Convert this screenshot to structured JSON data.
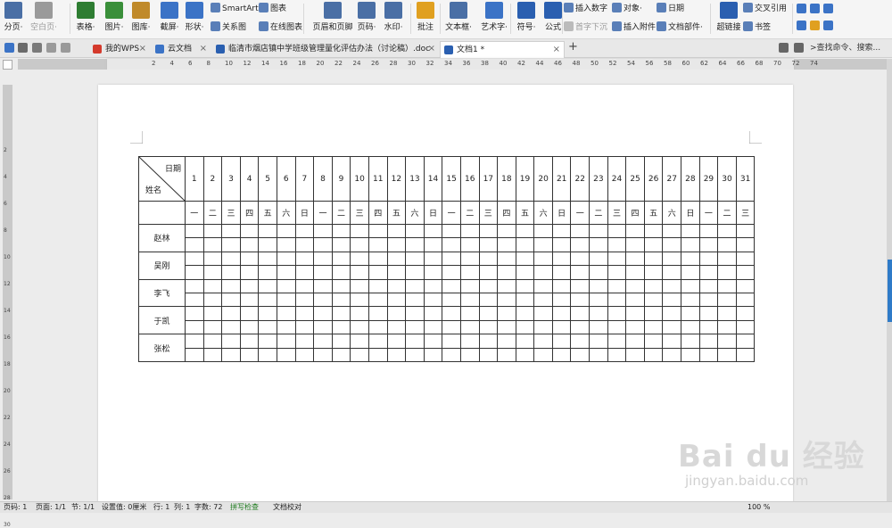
{
  "ribbon": {
    "big_buttons": [
      {
        "label": "分页·",
        "icon": "page-break-icon",
        "color": "#4a6fa5"
      },
      {
        "label": "空白页·",
        "icon": "blank-page-icon",
        "color": "#9a9a9a",
        "disabled": true
      },
      {
        "label": "表格·",
        "icon": "table-icon",
        "color": "#2e7d32"
      },
      {
        "label": "图片·",
        "icon": "picture-icon",
        "color": "#3a8f3a"
      },
      {
        "label": "图库·",
        "icon": "gallery-icon",
        "color": "#c08a2a"
      },
      {
        "label": "截屏·",
        "icon": "screenshot-icon",
        "color": "#3b73c6"
      },
      {
        "label": "形状·",
        "icon": "shape-icon",
        "color": "#3b73c6"
      },
      {
        "label": "页眉和页脚",
        "icon": "header-footer-icon",
        "color": "#4a6fa5"
      },
      {
        "label": "页码·",
        "icon": "page-number-icon",
        "color": "#4a6fa5"
      },
      {
        "label": "水印·",
        "icon": "watermark-icon",
        "color": "#4a6fa5"
      },
      {
        "label": "批注",
        "icon": "comment-icon",
        "color": "#e0a020"
      },
      {
        "label": "文本框·",
        "icon": "textbox-icon",
        "color": "#4a6fa5"
      },
      {
        "label": "艺术字·",
        "icon": "wordart-icon",
        "color": "#3b73c6"
      },
      {
        "label": "符号·",
        "icon": "symbol-icon",
        "color": "#2a5fb0"
      },
      {
        "label": "公式",
        "icon": "formula-icon",
        "color": "#2a5fb0"
      },
      {
        "label": "超链接",
        "icon": "hyperlink-icon",
        "color": "#2a5fb0"
      }
    ],
    "small_buttons": [
      {
        "label": "SmartArt",
        "icon": "smartart-icon"
      },
      {
        "label": "图表",
        "icon": "chart-icon"
      },
      {
        "label": "关系图",
        "icon": "relation-icon"
      },
      {
        "label": "在线图表",
        "icon": "online-chart-icon"
      },
      {
        "label": "插入数字",
        "icon": "insert-number-icon"
      },
      {
        "label": "对象·",
        "icon": "object-icon"
      },
      {
        "label": "日期",
        "icon": "date-icon"
      },
      {
        "label": "首字下沉",
        "icon": "dropcap-icon",
        "disabled": true
      },
      {
        "label": "插入附件",
        "icon": "attachment-icon"
      },
      {
        "label": "文档部件·",
        "icon": "doc-parts-icon"
      },
      {
        "label": "交叉引用",
        "icon": "cross-ref-icon"
      },
      {
        "label": "书签",
        "icon": "bookmark-icon"
      }
    ]
  },
  "tabs": [
    {
      "label": "我的WPS",
      "icon": "wps-icon",
      "color": "#d43a2c"
    },
    {
      "label": "云文档",
      "icon": "cloud-doc-icon",
      "color": "#3b73c6"
    },
    {
      "label": "临清市烟店镇中学班级管理量化评估办法（讨论稿）.doc",
      "icon": "doc-icon",
      "color": "#2a5fb0"
    },
    {
      "label": "文档1 *",
      "icon": "doc-icon",
      "color": "#2a5fb0",
      "active": true
    }
  ],
  "search_placeholder": ">查找命令、搜索...",
  "ruler_numbers": [
    "2",
    "4",
    "6",
    "8",
    "10",
    "12",
    "14",
    "16",
    "18",
    "20",
    "22",
    "24",
    "26",
    "28",
    "30",
    "32",
    "34",
    "36",
    "38",
    "40",
    "42",
    "44",
    "46",
    "48",
    "50",
    "52",
    "54",
    "56",
    "58",
    "60",
    "62",
    "64",
    "66",
    "68",
    "70",
    "72",
    "74"
  ],
  "vruler_numbers": [
    "2",
    "4",
    "6",
    "8",
    "10",
    "12",
    "14",
    "16",
    "18",
    "20",
    "22",
    "24",
    "26",
    "28",
    "30"
  ],
  "table": {
    "header_date": "日期",
    "header_name": "姓名",
    "days": [
      "1",
      "2",
      "3",
      "4",
      "5",
      "6",
      "7",
      "8",
      "9",
      "10",
      "11",
      "12",
      "13",
      "14",
      "15",
      "16",
      "17",
      "18",
      "19",
      "20",
      "21",
      "22",
      "23",
      "24",
      "25",
      "26",
      "27",
      "28",
      "29",
      "30",
      "31"
    ],
    "weekdays": [
      "一",
      "二",
      "三",
      "四",
      "五",
      "六",
      "日",
      "一",
      "二",
      "三",
      "四",
      "五",
      "六",
      "日",
      "一",
      "二",
      "三",
      "四",
      "五",
      "六",
      "日",
      "一",
      "二",
      "三",
      "四",
      "五",
      "六",
      "日",
      "一",
      "二",
      "三"
    ],
    "names": [
      "赵林",
      "吴刚",
      "李飞",
      "于凯",
      "张松"
    ]
  },
  "status": {
    "page_num": "页码: 1",
    "pages": "页面: 1/1",
    "section": "节: 1/1",
    "setting": "设置值: 0厘米",
    "row": "行: 1",
    "col": "列: 1",
    "words": "字数: 72",
    "spell": "拼写检查",
    "proof": "文档校对",
    "zoom": "100 %"
  },
  "watermark": {
    "main": "Bai du 经验",
    "sub": "jingyan.baidu.com"
  }
}
